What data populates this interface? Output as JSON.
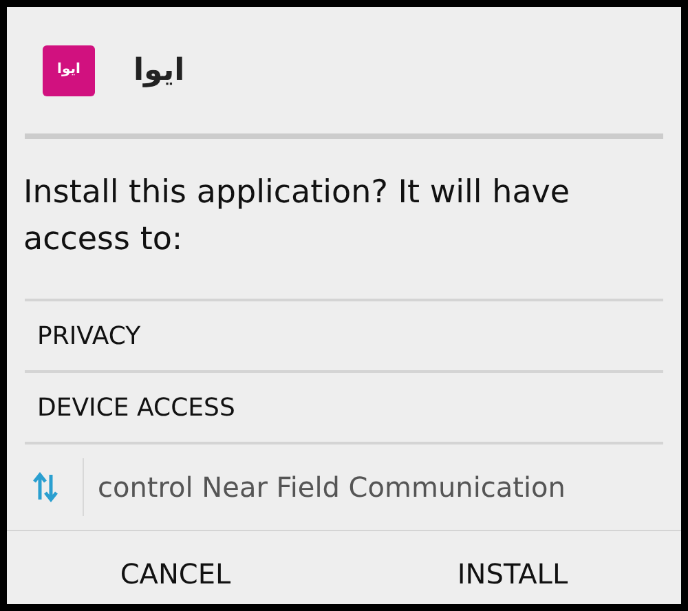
{
  "app": {
    "name": "ایوا",
    "logo_text": "ایوا"
  },
  "message": "Install this application? It will have access to:",
  "sections": [
    {
      "title": "PRIVACY"
    },
    {
      "title": "DEVICE ACCESS"
    }
  ],
  "permissions": [
    {
      "label": "control Near Field Communication"
    }
  ],
  "buttons": [
    {
      "label": "CANCEL"
    },
    {
      "label": "INSTALL"
    }
  ]
}
